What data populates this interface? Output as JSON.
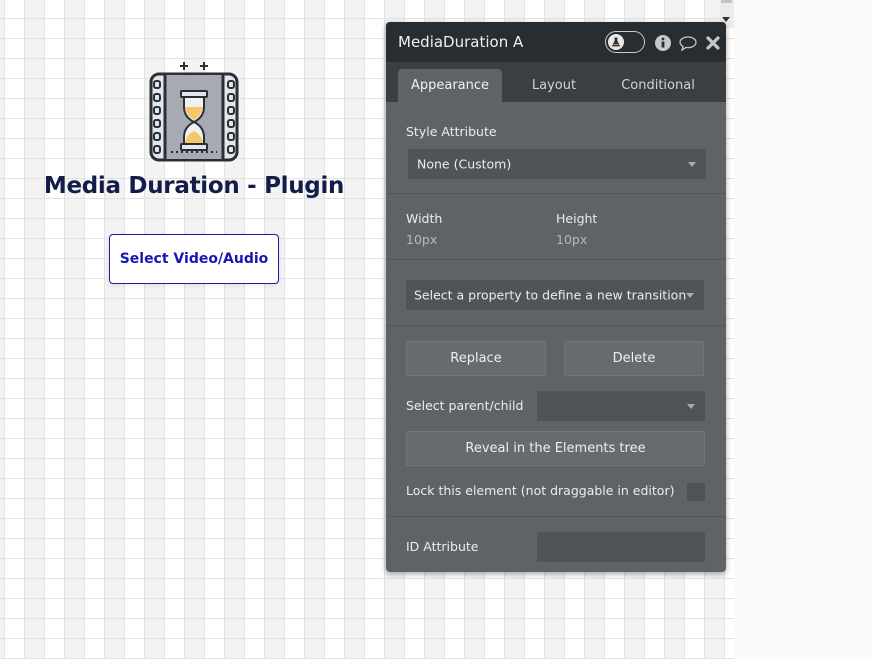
{
  "canvas": {
    "heading": "Media Duration - Plugin",
    "select_button_label": "Select Video/Audio",
    "logo_icon": "hourglass-film-icon"
  },
  "panel": {
    "title": "MediaDuration A",
    "header_icons": [
      "debug-toggle-flask-icon",
      "info-icon",
      "comment-icon",
      "close-icon"
    ],
    "tabs": [
      {
        "label": "Appearance",
        "active": true
      },
      {
        "label": "Layout",
        "active": false
      },
      {
        "label": "Conditional",
        "active": false
      }
    ],
    "style_attribute": {
      "label": "Style Attribute",
      "selected": "None (Custom)"
    },
    "width": {
      "label": "Width",
      "value": "10px"
    },
    "height": {
      "label": "Height",
      "value": "10px"
    },
    "transition": {
      "selected": "Select a property to define a new transition"
    },
    "replace_label": "Replace",
    "delete_label": "Delete",
    "parent_child": {
      "label": "Select parent/child",
      "selected": ""
    },
    "reveal_label": "Reveal in the Elements tree",
    "lock": {
      "label": "Lock this element (not draggable in editor)",
      "checked": false
    },
    "id_attribute": {
      "label": "ID Attribute",
      "value": ""
    }
  }
}
